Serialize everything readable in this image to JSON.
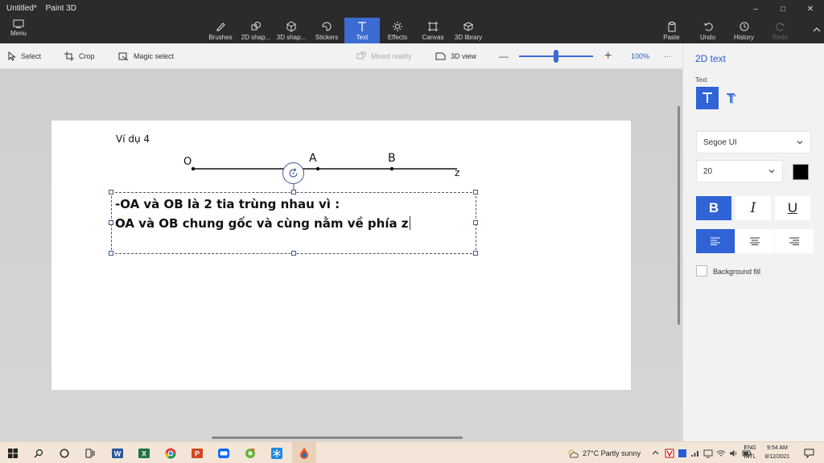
{
  "window": {
    "doc_title": "Untitled*",
    "app_title": "Paint 3D",
    "minimize": "–",
    "maximize": "□",
    "close": "✕"
  },
  "ribbon": {
    "menu_label": "Menu",
    "tools": [
      {
        "label": "Brushes",
        "icon": "brush-icon"
      },
      {
        "label": "2D shap...",
        "icon": "2d-shapes-icon"
      },
      {
        "label": "3D shap...",
        "icon": "3d-shapes-icon"
      },
      {
        "label": "Stickers",
        "icon": "sticker-icon"
      },
      {
        "label": "Text",
        "icon": "text-icon"
      },
      {
        "label": "Effects",
        "icon": "effects-icon"
      },
      {
        "label": "Canvas",
        "icon": "canvas-icon"
      },
      {
        "label": "3D library",
        "icon": "3d-library-icon"
      }
    ],
    "paste_label": "Paste",
    "undo_label": "Undo",
    "history_label": "History",
    "redo_label": "Redo"
  },
  "toolbar": {
    "select_label": "Select",
    "crop_label": "Crop",
    "magic_select_label": "Magic select",
    "mixed_reality_label": "Mixed reality",
    "view3d_label": "3D view",
    "zoom_out": "—",
    "zoom_in": "+",
    "zoom_level": "100%",
    "zoom_fraction": 0.5,
    "more": "···"
  },
  "canvas": {
    "example_label": "Ví dụ 4",
    "point_o": "O",
    "point_a": "A",
    "point_b": "B",
    "point_z": "z",
    "text_line1": "-OA và OB là 2 tia trùng nhau vì :",
    "text_line2": "OA và OB chung gốc và cùng nằm về phía z"
  },
  "panel": {
    "title": "2D text",
    "text_label": "Text",
    "font_name": "Segoe UI",
    "font_size": "20",
    "color": "#000000",
    "bold": "B",
    "italic": "I",
    "underline": "U",
    "background_fill_label": "Background fill"
  },
  "taskbar": {
    "weather": "27°C  Partly sunny",
    "lang_top": "ENG",
    "lang_bottom": "INTL",
    "time": "9:54 AM",
    "date": "8/12/2021"
  }
}
